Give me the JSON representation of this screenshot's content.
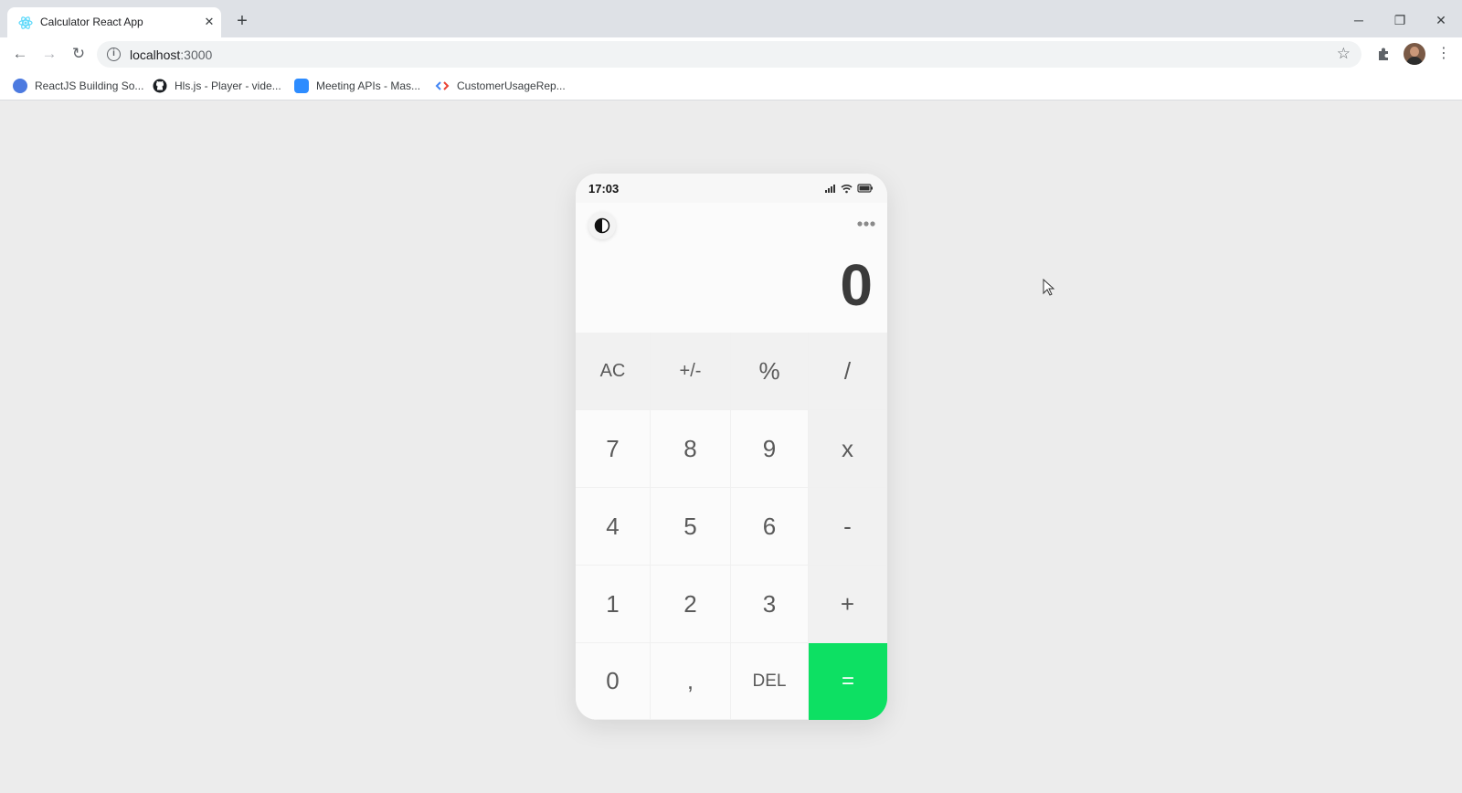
{
  "browser": {
    "tab_title": "Calculator React App",
    "url_host": "localhost",
    "url_port": ":3000",
    "bookmarks": [
      {
        "label": "ReactJS Building So...",
        "icon": "react-bookmark-icon",
        "color": "#4c7ae0"
      },
      {
        "label": "Hls.js - Player - vide...",
        "icon": "github-icon",
        "color": "#1b1f23"
      },
      {
        "label": "Meeting APIs - Mas...",
        "icon": "zoom-icon",
        "color": "#2d8cff"
      },
      {
        "label": "CustomerUsageRep...",
        "icon": "code-icon",
        "color": "#34a853"
      }
    ]
  },
  "calculator": {
    "status_time": "17:03",
    "display_value": "0",
    "accent_color": "#0de063",
    "keys": [
      {
        "label": "AC",
        "name": "key-clear-all"
      },
      {
        "label": "+/-",
        "name": "key-toggle-sign"
      },
      {
        "label": "%",
        "name": "key-percent"
      },
      {
        "label": "/",
        "name": "key-divide"
      },
      {
        "label": "7",
        "name": "key-7"
      },
      {
        "label": "8",
        "name": "key-8"
      },
      {
        "label": "9",
        "name": "key-9"
      },
      {
        "label": "x",
        "name": "key-multiply"
      },
      {
        "label": "4",
        "name": "key-4"
      },
      {
        "label": "5",
        "name": "key-5"
      },
      {
        "label": "6",
        "name": "key-6"
      },
      {
        "label": "-",
        "name": "key-subtract"
      },
      {
        "label": "1",
        "name": "key-1"
      },
      {
        "label": "2",
        "name": "key-2"
      },
      {
        "label": "3",
        "name": "key-3"
      },
      {
        "label": "+",
        "name": "key-add"
      },
      {
        "label": "0",
        "name": "key-0"
      },
      {
        "label": ",",
        "name": "key-decimal"
      },
      {
        "label": "DEL",
        "name": "key-delete"
      },
      {
        "label": "=",
        "name": "key-equals"
      }
    ]
  }
}
